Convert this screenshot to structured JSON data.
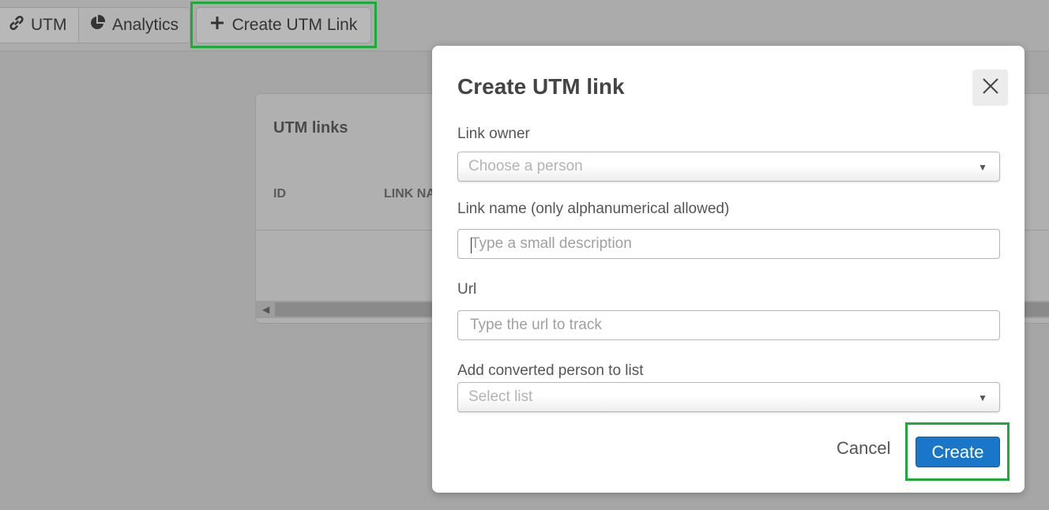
{
  "toolbar": {
    "utm_label": "UTM",
    "analytics_label": "Analytics",
    "create_label": "Create UTM Link"
  },
  "card": {
    "title": "UTM links",
    "columns": [
      "ID",
      "LINK NA"
    ]
  },
  "modal": {
    "title": "Create UTM link",
    "link_owner_label": "Link owner",
    "link_owner_placeholder": "Choose a person",
    "link_name_label": "Link name (only alphanumerical allowed)",
    "link_name_placeholder": "Type a small description",
    "url_label": "Url",
    "url_placeholder": "Type the url to track",
    "list_label": "Add converted person to list",
    "list_placeholder": "Select list",
    "cancel_label": "Cancel",
    "create_label": "Create"
  },
  "colors": {
    "accent": "#1a76c9",
    "highlight": "#1aab3a",
    "overlay": "#a6a6a6"
  },
  "icons": [
    "link-icon",
    "pie-chart-icon",
    "plus-icon",
    "close-icon",
    "caret-down-icon"
  ]
}
